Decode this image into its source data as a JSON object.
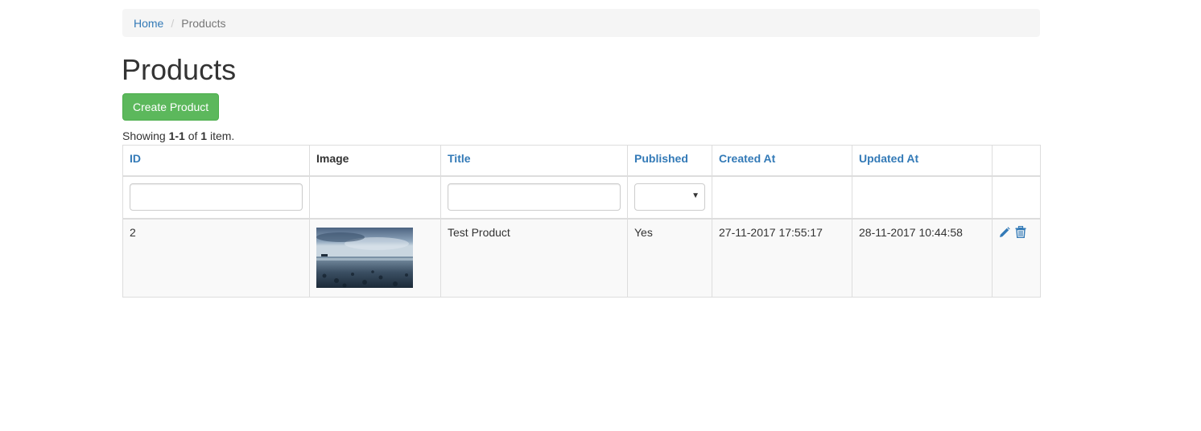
{
  "breadcrumb": {
    "home": "Home",
    "current": "Products",
    "separator": "/"
  },
  "page": {
    "title": "Products",
    "create_button": "Create Product"
  },
  "summary": {
    "prefix": "Showing ",
    "range": "1-1",
    "middle": " of ",
    "total": "1",
    "suffix": " item."
  },
  "table": {
    "columns": {
      "id": "ID",
      "image": "Image",
      "title": "Title",
      "published": "Published",
      "created_at": "Created At",
      "updated_at": "Updated At"
    },
    "filters": {
      "id": "",
      "title": "",
      "published": ""
    },
    "rows": [
      {
        "id": "2",
        "image": "product-thumbnail",
        "title": "Test Product",
        "published": "Yes",
        "created_at": "27-11-2017 17:55:17",
        "updated_at": "28-11-2017 10:44:58"
      }
    ]
  },
  "icons": {
    "update": "pencil-icon",
    "delete": "trash-icon"
  },
  "colors": {
    "link": "#337ab7",
    "success": "#5cb85c",
    "stripe": "#f9f9f9"
  }
}
